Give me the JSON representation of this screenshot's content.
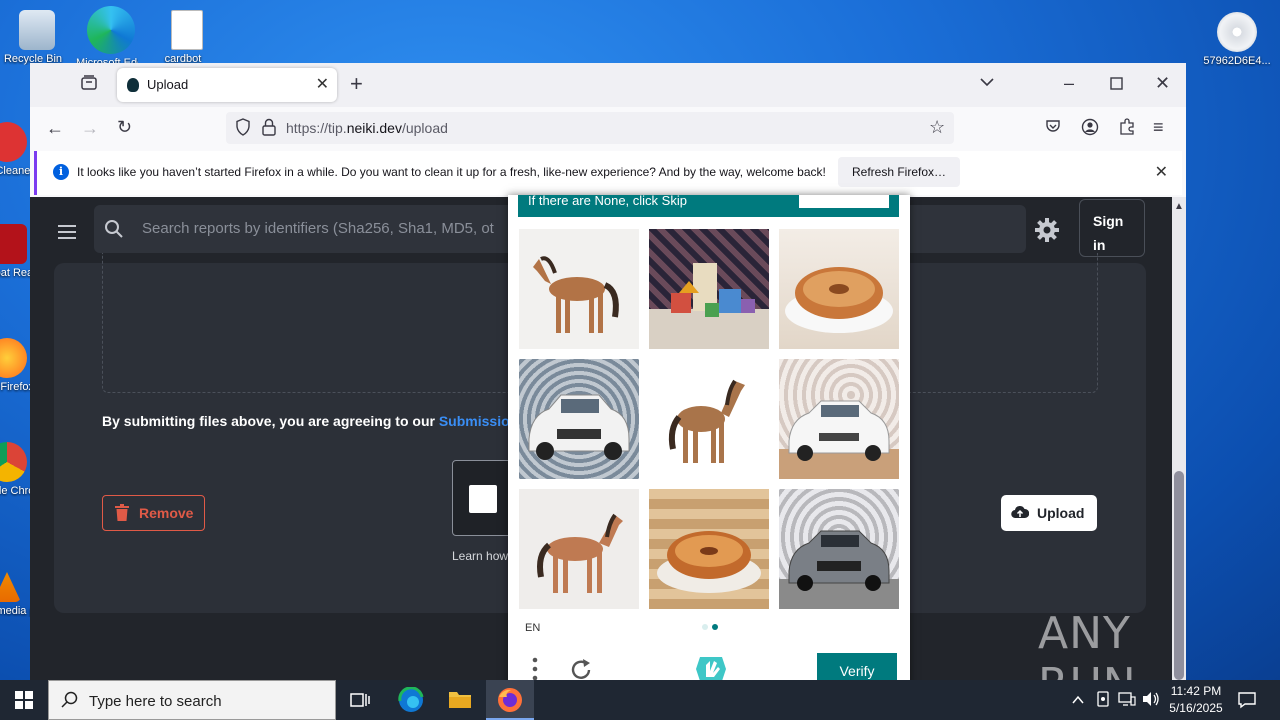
{
  "desktop": {
    "icons": [
      {
        "label": "Recycle Bin"
      },
      {
        "label": "Microsoft Edge"
      },
      {
        "label": "cardbot"
      },
      {
        "label": "57962D6E4..."
      },
      {
        "label": "CCleaner"
      },
      {
        "label": "Acrobat Reader"
      },
      {
        "label": "Firefox"
      },
      {
        "label": "Google Chrome"
      },
      {
        "label": "VLC media player"
      }
    ]
  },
  "browser": {
    "tab_title": "Upload",
    "url_prefix": "https://tip.",
    "url_domain": "neiki.dev",
    "url_path": "/upload",
    "notification": {
      "message": "It looks like you haven’t started Firefox in a while. Do you want to clean it up for a fresh, like-new experience? And by the way, welcome back!",
      "button": "Refresh Firefox…"
    }
  },
  "page": {
    "search_placeholder": "Search reports by identifiers (Sha256, Sha1, MD5, ot",
    "signin_line1": "Sign",
    "signin_line2": "in",
    "agree_text": "By submitting files above, you are agreeing to our ",
    "agree_link": "Submission",
    "remove_label": "Remove",
    "upload_label": "Upload",
    "learn_text": "Learn how"
  },
  "captcha": {
    "instruction": "If there are None, click Skip",
    "language": "EN",
    "verify_label": "Verify",
    "images": [
      "horse",
      "toy-blocks",
      "donut",
      "car",
      "horse",
      "car",
      "horse",
      "donut",
      "car"
    ],
    "accent": "#007a7e"
  },
  "taskbar": {
    "search_placeholder": "Type here to search",
    "time": "11:42 PM",
    "date": "5/16/2025"
  },
  "watermark": "ANY RUN"
}
